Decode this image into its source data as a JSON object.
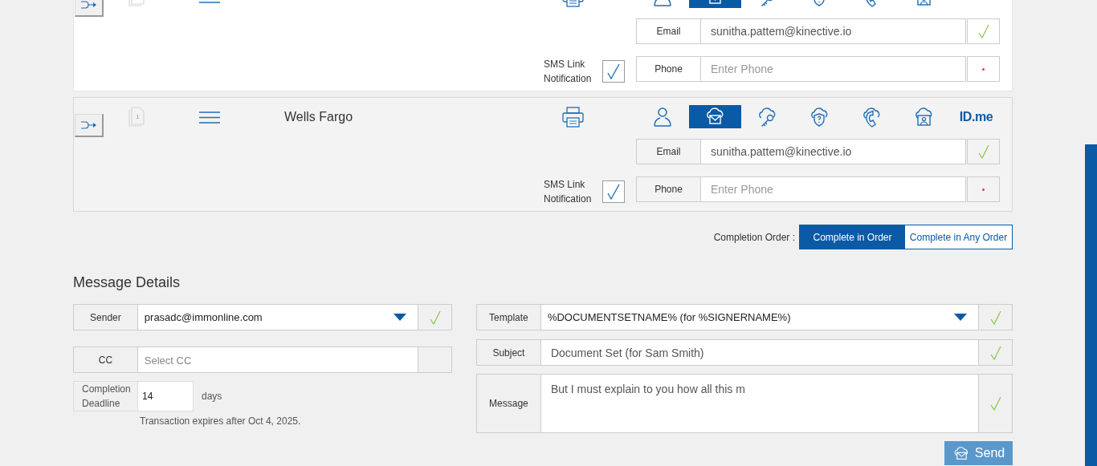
{
  "signers": [
    {
      "selected": false,
      "auth_methods": [
        {
          "kind": "person",
          "selected": false
        },
        {
          "kind": "email",
          "selected": true
        },
        {
          "kind": "key",
          "selected": false
        },
        {
          "kind": "question",
          "selected": false
        },
        {
          "kind": "phone",
          "selected": false
        },
        {
          "kind": "video",
          "selected": false
        }
      ],
      "email": {
        "label": "Email",
        "value": "sunitha.pattem@kinective.io",
        "valid": true
      },
      "sms": {
        "label": "SMS Link Notification",
        "checked": true
      },
      "phone": {
        "label": "Phone",
        "placeholder": "Enter Phone",
        "valid": false
      }
    },
    {
      "name": "Wells Fargo",
      "page_count": "1",
      "selected": true,
      "auth_methods": [
        {
          "kind": "person",
          "selected": false
        },
        {
          "kind": "email",
          "selected": true
        },
        {
          "kind": "key",
          "selected": false
        },
        {
          "kind": "question",
          "selected": false
        },
        {
          "kind": "phone",
          "selected": false
        },
        {
          "kind": "video",
          "selected": false
        },
        {
          "kind": "idme",
          "label": "ID.me",
          "selected": false
        }
      ],
      "email": {
        "label": "Email",
        "value": "sunitha.pattem@kinective.io",
        "valid": true
      },
      "sms": {
        "label": "SMS Link Notification",
        "checked": true
      },
      "phone": {
        "label": "Phone",
        "placeholder": "Enter Phone",
        "valid": false
      }
    }
  ],
  "completion_order": {
    "label": "Completion Order :",
    "options": [
      {
        "label": "Complete in Order",
        "selected": true
      },
      {
        "label": "Complete in Any Order",
        "selected": false
      }
    ]
  },
  "message_details": {
    "title": "Message Details",
    "sender": {
      "label": "Sender",
      "value": "prasadc@immonline.com",
      "valid": true
    },
    "cc": {
      "label": "CC",
      "placeholder": "Select CC"
    },
    "deadline": {
      "label": "Completion Deadline",
      "value": "14",
      "unit": "days",
      "note": "Transaction expires after Oct 4, 2025."
    },
    "template": {
      "label": "Template",
      "value": "%DOCUMENTSETNAME% (for %SIGNERNAME%)",
      "valid": true
    },
    "subject": {
      "label": "Subject",
      "value": "Document Set (for Sam Smith)",
      "valid": true
    },
    "message": {
      "label": "Message",
      "value": "But I must explain to you how all this m",
      "valid": true
    },
    "send_button": "Send"
  }
}
